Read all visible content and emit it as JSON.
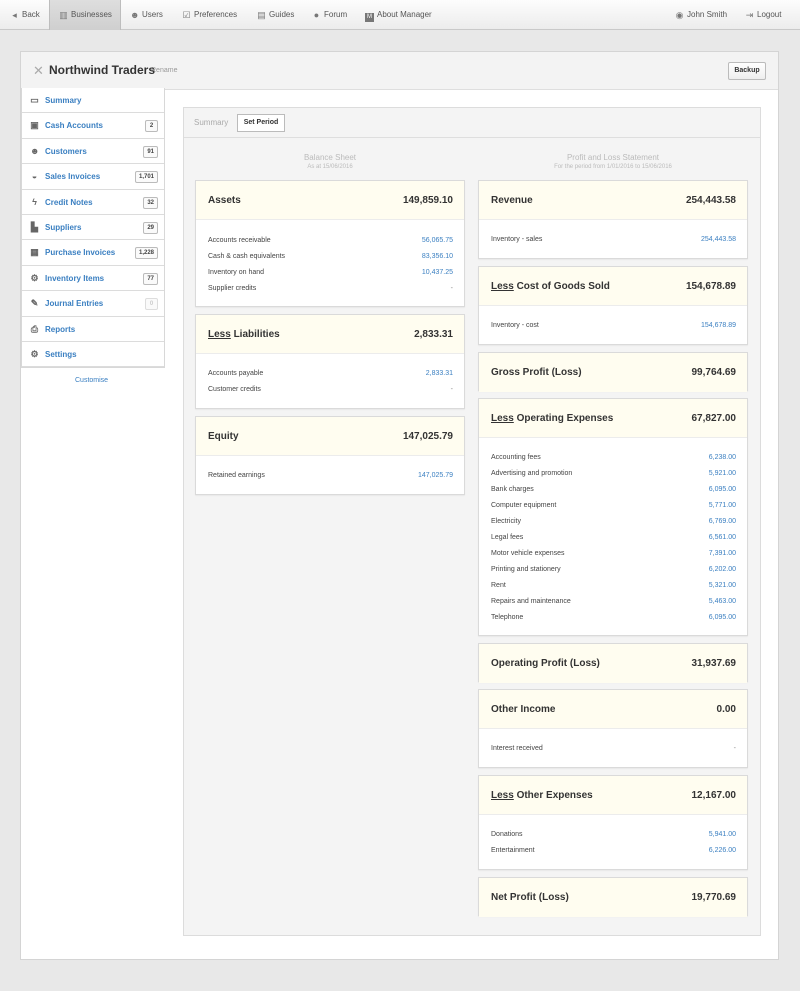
{
  "nav": {
    "back": "Back",
    "businesses": "Businesses",
    "users": "Users",
    "preferences": "Preferences",
    "guides": "Guides",
    "forum": "Forum",
    "about": "About Manager",
    "user": "John Smith",
    "logout": "Logout"
  },
  "business": {
    "name": "Northwind Traders",
    "rename": "Rename",
    "backup": "Backup"
  },
  "sidebar": {
    "summary": "Summary",
    "cash_accounts": "Cash Accounts",
    "cash_accounts_count": "2",
    "customers": "Customers",
    "customers_count": "91",
    "sales_invoices": "Sales Invoices",
    "sales_invoices_count": "1,701",
    "credit_notes": "Credit Notes",
    "credit_notes_count": "32",
    "suppliers": "Suppliers",
    "suppliers_count": "29",
    "purchase_invoices": "Purchase Invoices",
    "purchase_invoices_count": "1,228",
    "inventory_items": "Inventory Items",
    "inventory_items_count": "77",
    "journal_entries": "Journal Entries",
    "journal_entries_count": "0",
    "reports": "Reports",
    "settings": "Settings",
    "customise": "Customise"
  },
  "panel": {
    "tab_summary": "Summary",
    "set_period": "Set Period"
  },
  "balance": {
    "title": "Balance Sheet",
    "subtitle": "As at 15/06/2016",
    "less": "Less",
    "assets": {
      "title": "Assets",
      "total": "149,859.10",
      "r1_l": "Accounts receivable",
      "r1_v": "56,065.75",
      "r2_l": "Cash & cash equivalents",
      "r2_v": "83,356.10",
      "r3_l": "Inventory on hand",
      "r3_v": "10,437.25",
      "r4_l": "Supplier credits",
      "r4_v": "-"
    },
    "liabilities": {
      "title": "Liabilities",
      "total": "2,833.31",
      "r1_l": "Accounts payable",
      "r1_v": "2,833.31",
      "r2_l": "Customer credits",
      "r2_v": "-"
    },
    "equity": {
      "title": "Equity",
      "total": "147,025.79",
      "r1_l": "Retained earnings",
      "r1_v": "147,025.79"
    }
  },
  "pl": {
    "title": "Profit and Loss Statement",
    "subtitle": "For the period from 1/01/2016 to 15/06/2016",
    "less": "Less",
    "revenue": {
      "title": "Revenue",
      "total": "254,443.58",
      "r1_l": "Inventory - sales",
      "r1_v": "254,443.58"
    },
    "cogs": {
      "title": "Cost of Goods Sold",
      "total": "154,678.89",
      "r1_l": "Inventory - cost",
      "r1_v": "154,678.89"
    },
    "gross": {
      "title": "Gross Profit (Loss)",
      "total": "99,764.69"
    },
    "opex": {
      "title": "Operating Expenses",
      "total": "67,827.00",
      "items": [
        {
          "label": "Accounting fees",
          "value": "6,238.00"
        },
        {
          "label": "Advertising and promotion",
          "value": "5,921.00"
        },
        {
          "label": "Bank charges",
          "value": "6,095.00"
        },
        {
          "label": "Computer equipment",
          "value": "5,771.00"
        },
        {
          "label": "Electricity",
          "value": "6,769.00"
        },
        {
          "label": "Legal fees",
          "value": "6,561.00"
        },
        {
          "label": "Motor vehicle expenses",
          "value": "7,391.00"
        },
        {
          "label": "Printing and stationery",
          "value": "6,202.00"
        },
        {
          "label": "Rent",
          "value": "5,321.00"
        },
        {
          "label": "Repairs and maintenance",
          "value": "5,463.00"
        },
        {
          "label": "Telephone",
          "value": "6,095.00"
        }
      ]
    },
    "op_profit": {
      "title": "Operating Profit (Loss)",
      "total": "31,937.69"
    },
    "other_income": {
      "title": "Other Income",
      "total": "0.00",
      "r1_l": "Interest received",
      "r1_v": "-"
    },
    "other_exp": {
      "title": "Other Expenses",
      "total": "12,167.00",
      "r1_l": "Donations",
      "r1_v": "5,941.00",
      "r2_l": "Entertainment",
      "r2_v": "6,226.00"
    },
    "net": {
      "title": "Net Profit (Loss)",
      "total": "19,770.69"
    }
  }
}
